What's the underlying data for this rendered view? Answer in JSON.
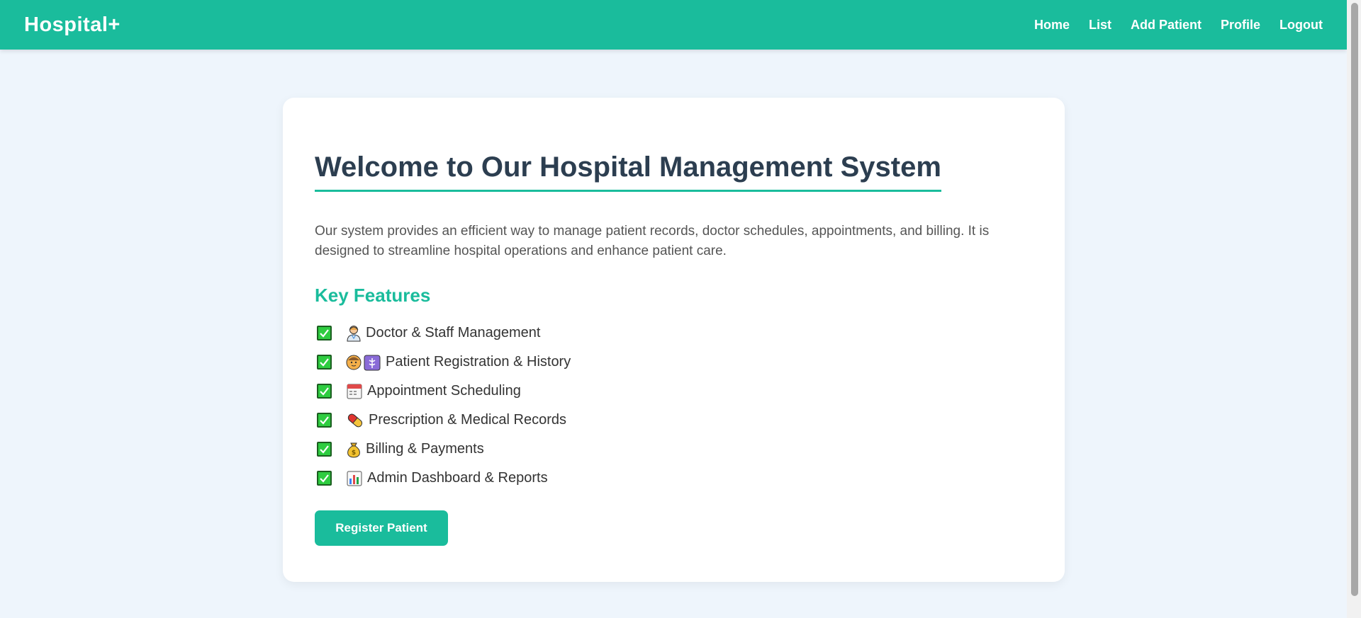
{
  "navbar": {
    "brand": "Hospital+",
    "links": [
      {
        "label": "Home"
      },
      {
        "label": "List"
      },
      {
        "label": "Add Patient"
      },
      {
        "label": "Profile"
      },
      {
        "label": "Logout"
      }
    ]
  },
  "main": {
    "title": "Welcome to Our Hospital Management System",
    "description": "Our system provides an efficient way to manage patient records, doctor schedules, appointments, and billing. It is designed to streamline hospital operations and enhance patient care.",
    "features_title": "Key Features",
    "features": [
      {
        "icon": "doctor-icon",
        "label": "Doctor & Staff Management"
      },
      {
        "icon": "patient-icon",
        "label": "Patient Registration & History"
      },
      {
        "icon": "calendar-icon",
        "label": "Appointment Scheduling"
      },
      {
        "icon": "pill-icon",
        "label": "Prescription & Medical Records"
      },
      {
        "icon": "money-bag-icon",
        "label": "Billing & Payments"
      },
      {
        "icon": "bar-chart-icon",
        "label": "Admin Dashboard & Reports"
      }
    ],
    "register_button": "Register Patient"
  },
  "colors": {
    "accent": "#1abc9c",
    "title": "#2c3e50",
    "background": "#eef5fc"
  }
}
